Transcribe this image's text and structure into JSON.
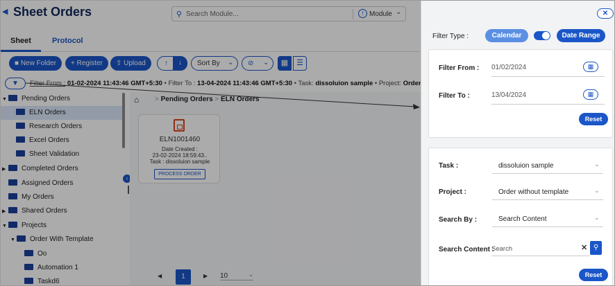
{
  "app": {
    "title": "Sheet Orders",
    "search_placeholder": "Search Module...",
    "module_label": "Module"
  },
  "tabs": [
    {
      "label": "Sheet"
    },
    {
      "label": "Protocol"
    }
  ],
  "toolbar": {
    "new_folder": "New Folder",
    "register": "Register",
    "upload": "Upload",
    "sort_by": "Sort By"
  },
  "filter_summary": {
    "from_label": "Filter From :",
    "from_value": "01-02-2024 11:43:46 GMT+5:30",
    "to_label": "Filter To :",
    "to_value": "13-04-2024 11:43:46 GMT+5:30",
    "task_label": "Task:",
    "task_value": "dissoluion sample",
    "project_label": "Project:",
    "project_value": "Order witho"
  },
  "tree": [
    {
      "label": "Pending Orders",
      "level": 0,
      "caret": "▼"
    },
    {
      "label": "ELN Orders",
      "level": 1,
      "caret": "",
      "selected": true
    },
    {
      "label": "Research Orders",
      "level": 1,
      "caret": ""
    },
    {
      "label": "Excel Orders",
      "level": 1,
      "caret": ""
    },
    {
      "label": "Sheet Validation",
      "level": 1,
      "caret": ""
    },
    {
      "label": "Completed Orders",
      "level": 0,
      "caret": "▶"
    },
    {
      "label": "Assigned Orders",
      "level": 0,
      "caret": ""
    },
    {
      "label": "My Orders",
      "level": 0,
      "caret": ""
    },
    {
      "label": "Shared Orders",
      "level": 0,
      "caret": "▶"
    },
    {
      "label": "Projects",
      "level": 0,
      "caret": "▼"
    },
    {
      "label": "Order With Template",
      "level": 1,
      "caret": "▼"
    },
    {
      "label": "Oo",
      "level": 2,
      "caret": ""
    },
    {
      "label": "Automation 1",
      "level": 2,
      "caret": ""
    },
    {
      "label": "Taskd6",
      "level": 2,
      "caret": ""
    }
  ],
  "breadcrumb": {
    "item1": "Pending Orders",
    "sep": ">",
    "item2": "ELN Orders"
  },
  "order_card": {
    "id": "ELN1001460",
    "date_label": "Date Created :",
    "date_value": "23-02-2024 18:59:43..",
    "task": "Task : dissoluion sample",
    "button": "PROCESS ORDER"
  },
  "pager": {
    "page": "1",
    "page_size": "10"
  },
  "panel": {
    "filter_type_label": "Filter Type :",
    "calendar_label": "Calendar",
    "date_range_label": "Date Range",
    "filter_from_label": "Filter From :",
    "filter_from_value": "01/02/2024",
    "filter_to_label": "Filter To :",
    "filter_to_value": "13/04/2024",
    "reset_label": "Reset",
    "task_label": "Task :",
    "task_value": "dissoluion sample",
    "project_label": "Project :",
    "project_value": "Order without template",
    "search_by_label": "Search By :",
    "search_by_value": "Search Content",
    "search_content_label": "Search Content :",
    "search_content_placeholder": "Search",
    "reset2_label": "Reset"
  },
  "colors": {
    "accent": "#1a56c8",
    "calendar_btn": "#5b8fe3",
    "title": "#13295a"
  }
}
